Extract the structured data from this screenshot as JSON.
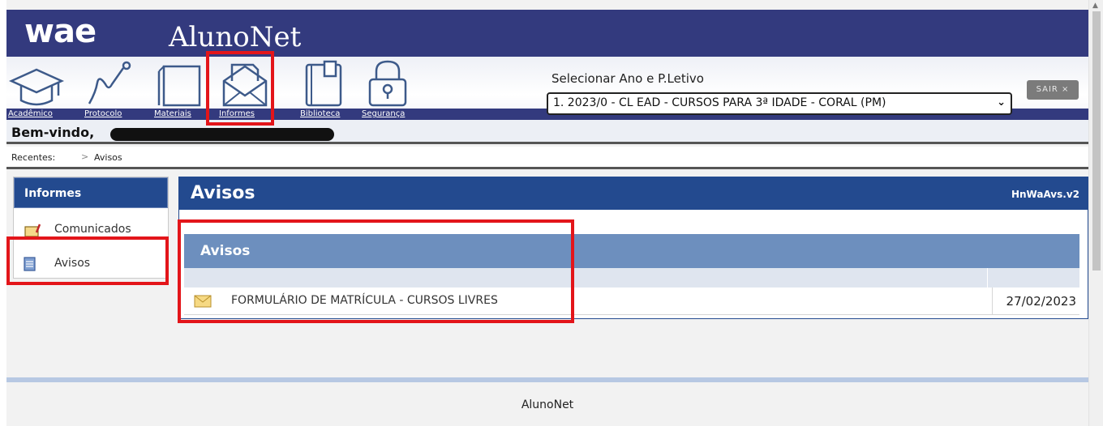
{
  "header": {
    "logo": "wae",
    "app_title": "AlunoNet"
  },
  "nav": {
    "items": [
      {
        "label": "Acadêmico",
        "icon": "graduation-cap-icon"
      },
      {
        "label": "Protocolo",
        "icon": "chart-line-icon"
      },
      {
        "label": "Materiais",
        "icon": "book-icon"
      },
      {
        "label": "Informes",
        "icon": "envelope-icon"
      },
      {
        "label": "Biblioteca",
        "icon": "library-book-icon"
      },
      {
        "label": "Segurança",
        "icon": "lock-icon"
      }
    ]
  },
  "periodo": {
    "label": "Selecionar Ano e P.Letivo",
    "selected": "1. 2023/0 - CL EAD - CURSOS PARA 3ª IDADE - CORAL (PM)"
  },
  "sair_label": "SAIR ×",
  "welcome": {
    "text": "Bem-vindo,"
  },
  "breadcrumb": {
    "recent": "Recentes:",
    "separator": ">",
    "current": "Avisos"
  },
  "sidebar": {
    "title": "Informes",
    "items": [
      {
        "label": "Comunicados",
        "icon": "notepad-icon"
      },
      {
        "label": "Avisos",
        "icon": "document-icon"
      }
    ]
  },
  "main": {
    "title": "Avisos",
    "version": "HnWaAvs.v2",
    "section_title": "Avisos",
    "rows": [
      {
        "title": "FORMULÁRIO DE MATRÍCULA - CURSOS LIVRES",
        "date": "27/02/2023",
        "icon": "envelope-icon"
      }
    ]
  },
  "footer": {
    "text": "AlunoNet"
  },
  "colors": {
    "header": "#333a7e",
    "panel_header": "#234a8f",
    "section_header": "#6d8fbe",
    "highlight": "#e3151a"
  }
}
